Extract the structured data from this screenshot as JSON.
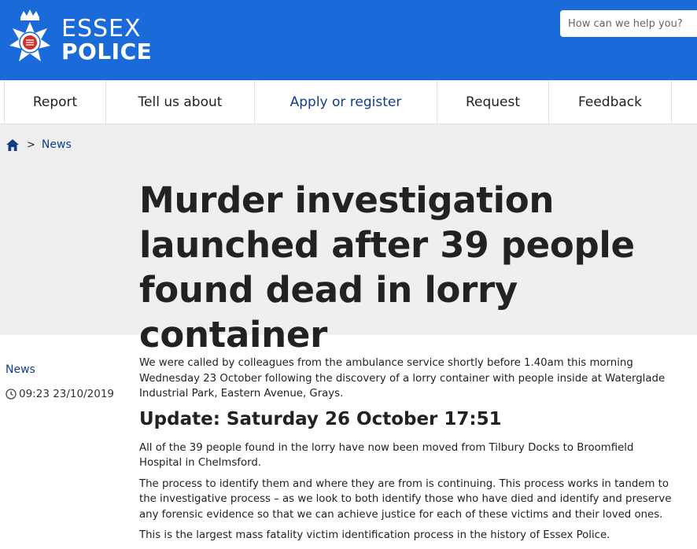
{
  "header": {
    "brand_line1": "ESSEX",
    "brand_line2": "POLICE",
    "search_placeholder": "How can we help you?",
    "bg_color": "#1b6ad9"
  },
  "nav": {
    "items": [
      {
        "label": "Report"
      },
      {
        "label": "Tell us about"
      },
      {
        "label": "Apply or register"
      },
      {
        "label": "Request"
      },
      {
        "label": "Feedback"
      }
    ],
    "active_color": "#103d8c"
  },
  "breadcrumb": {
    "home_icon": "home-icon",
    "separator": ">",
    "current": "News"
  },
  "article": {
    "title": "Murder investigation launched after 39 people found dead in lorry container",
    "category": "News",
    "timestamp": "09:23 23/10/2019",
    "intro": "We were called by colleagues from the ambulance service shortly before 1.40am this morning Wednesday 23 October following the discovery of a lorry container with people inside at Waterglade Industrial Park, Eastern Avenue, Grays.",
    "update_heading": "Update: Saturday 26 October 17:51",
    "paragraphs": [
      "All of the 39 people found in the lorry have now been moved from Tilbury Docks to Broomfield Hospital in Chelmsford.",
      "The process to identify them and where they are from is continuing. This process works in tandem to the investigative process – as we look to both identify those who have died and identify and preserve any forensic evidence so that we can achieve justice for each of these victims and their loved ones.",
      "This is the largest mass fatality victim identification process in the history of Essex Police."
    ]
  }
}
